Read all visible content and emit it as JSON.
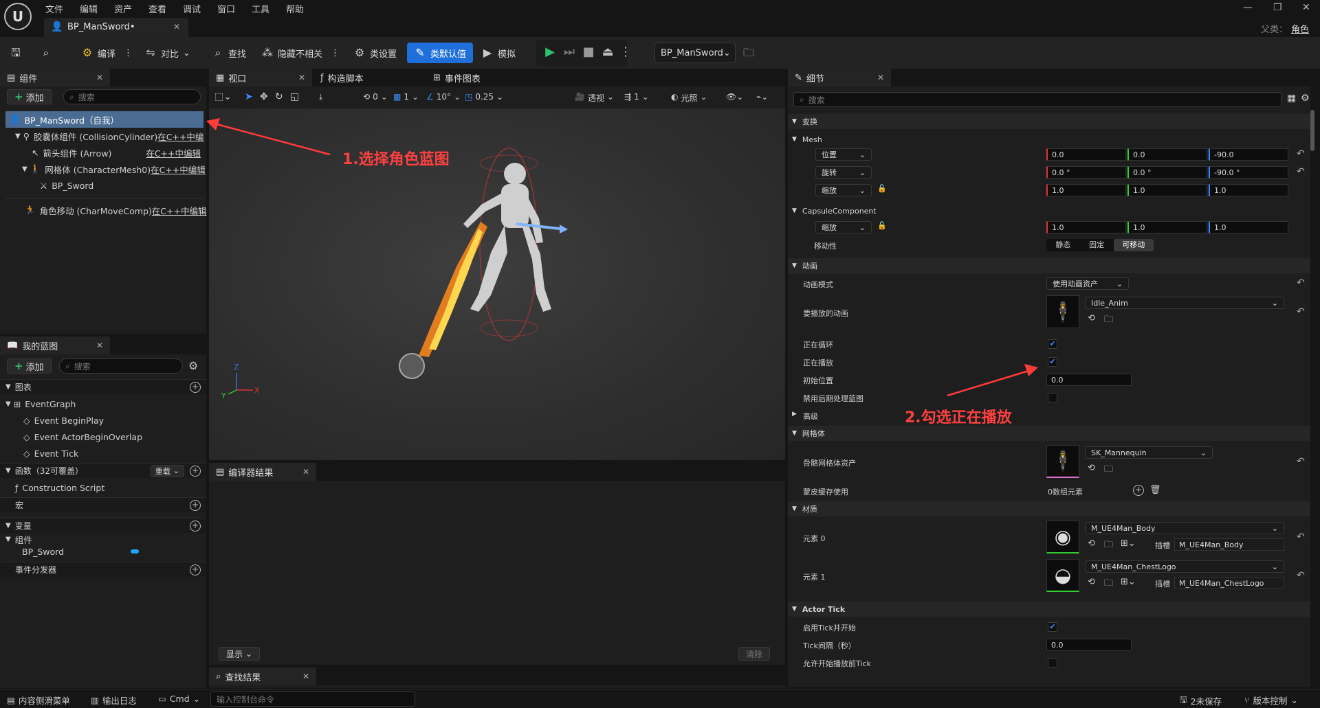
{
  "menu": [
    "文件",
    "编辑",
    "资产",
    "查看",
    "调试",
    "窗口",
    "工具",
    "帮助"
  ],
  "tab": {
    "title": "BP_ManSword•"
  },
  "parent": {
    "label": "父类：",
    "value": "角色"
  },
  "toolbar": {
    "compile": "编译",
    "diff": "对比",
    "find": "查找",
    "hide_unrelated": "隐藏不相关",
    "class_settings": "类设置",
    "class_defaults": "类默认值",
    "simulate": "模拟",
    "debug_object": "BP_ManSword"
  },
  "components": {
    "tab": "组件",
    "add": "添加",
    "search_placeholder": "搜索",
    "items": [
      {
        "name": "BP_ManSword（自我）",
        "link": ""
      },
      {
        "name": "胶囊体组件 (CollisionCylinder)",
        "link": "在C++中编"
      },
      {
        "name": "箭头组件 (Arrow)",
        "link": "在C++中编辑"
      },
      {
        "name": "网格体 (CharacterMesh0)",
        "link": "在C++中编辑"
      },
      {
        "name": "BP_Sword",
        "link": ""
      },
      {
        "name": "角色移动 (CharMoveComp)",
        "link": "在C++中编辑"
      }
    ]
  },
  "mybp": {
    "tab": "我的蓝图",
    "add": "添加",
    "search_placeholder": "搜索",
    "graphs": "图表",
    "event_graph": "EventGraph",
    "events": [
      "Event BeginPlay",
      "Event ActorBeginOverlap",
      "Event Tick"
    ],
    "functions": "函数（32可覆盖）",
    "override": "重载",
    "construction": "Construction Script",
    "macros": "宏",
    "variables": "变量",
    "components": "组件",
    "bp_sword": "BP_Sword",
    "dispatchers": "事件分发器"
  },
  "viewport": {
    "tab": "视口",
    "construction": "构造脚本",
    "event_graph": "事件图表",
    "tools": {
      "rot": "0",
      "grid": "1",
      "angle": "10°",
      "scale": "0.25",
      "view": "透视",
      "speed": "1",
      "lit": "光照"
    }
  },
  "compiler": {
    "tab": "编译器结果",
    "show": "显示",
    "clear": "清除"
  },
  "find": {
    "tab": "查找结果"
  },
  "details": {
    "tab": "细节",
    "search_placeholder": "搜索",
    "transform": "变换",
    "mesh": "Mesh",
    "location": {
      "label": "位置",
      "x": "0.0",
      "y": "0.0",
      "z": "-90.0"
    },
    "rotation": {
      "label": "旋转",
      "x": "0.0 °",
      "y": "0.0 °",
      "z": "-90.0 °"
    },
    "scale": {
      "label": "缩放",
      "x": "1.0",
      "y": "1.0",
      "z": "1.0"
    },
    "capsule": "CapsuleComponent",
    "capsule_scale": {
      "label": "缩放",
      "x": "1.0",
      "y": "1.0",
      "z": "1.0"
    },
    "mobility": {
      "label": "移动性",
      "options": [
        "静态",
        "固定",
        "可移动"
      ]
    },
    "animation": "动画",
    "anim_mode": {
      "label": "动画模式",
      "value": "使用动画资产"
    },
    "anim_to_play": {
      "label": "要播放的动画",
      "value": "Idle_Anim"
    },
    "looping": "正在循环",
    "playing": "正在播放",
    "init_pos": {
      "label": "初始位置",
      "value": "0.0"
    },
    "disable_post": "禁用后期处理蓝图",
    "advanced": "高级",
    "mesh_cat": "网格体",
    "skel_mesh": {
      "label": "骨骼网格体资产",
      "value": "SK_Mannequin"
    },
    "skin_cache": {
      "label": "蒙皮缓存使用",
      "value": "0数组元素"
    },
    "materials": "材质",
    "elem0": {
      "label": "元素 0",
      "value": "M_UE4Man_Body",
      "slot_label": "插槽",
      "slot": "M_UE4Man_Body"
    },
    "elem1": {
      "label": "元素 1",
      "value": "M_UE4Man_ChestLogo",
      "slot_label": "插槽",
      "slot": "M_UE4Man_ChestLogo"
    },
    "actor_tick": "Actor Tick",
    "tick_enabled": "启用Tick并开始",
    "tick_interval": {
      "label": "Tick间隔（秒）",
      "value": "0.0"
    },
    "tick_before_play": "允许开始播放前Tick"
  },
  "annotations": {
    "step1": "1.选择角色蓝图",
    "step2": "2.勾选正在播放"
  },
  "status": {
    "content_drawer": "内容侧滑菜单",
    "output_log": "输出日志",
    "cmd": "Cmd",
    "console_placeholder": "输入控制台命令",
    "unsaved": "2未保存",
    "source_control": "版本控制"
  }
}
